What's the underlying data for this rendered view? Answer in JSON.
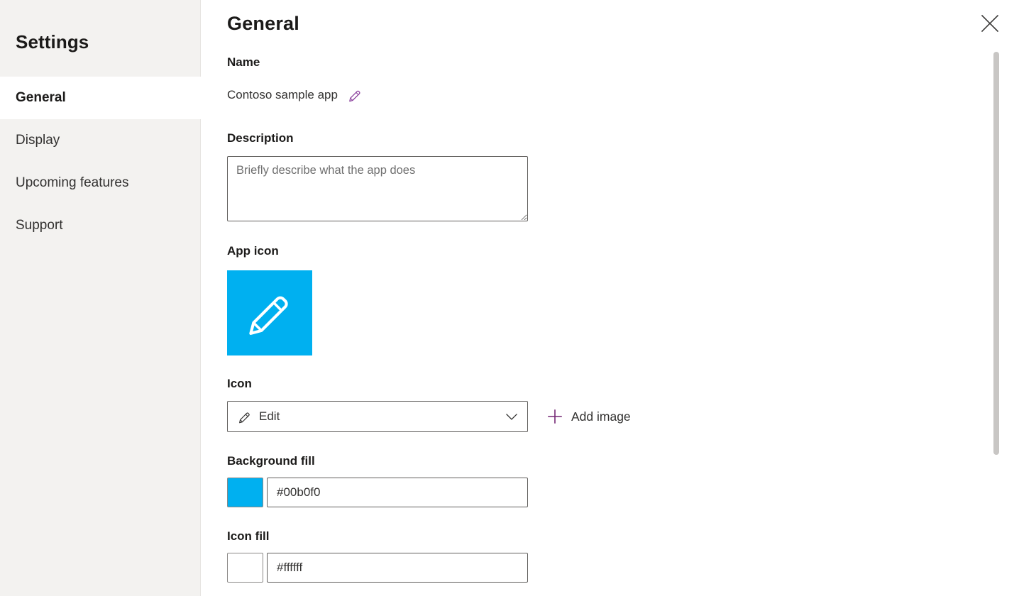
{
  "sidebar": {
    "title": "Settings",
    "items": [
      {
        "label": "General",
        "selected": true
      },
      {
        "label": "Display",
        "selected": false
      },
      {
        "label": "Upcoming features",
        "selected": false
      },
      {
        "label": "Support",
        "selected": false
      }
    ]
  },
  "header": {
    "title": "General",
    "close_label": "Close",
    "close_icon": "close-icon"
  },
  "form": {
    "name": {
      "label": "Name",
      "value": "Contoso sample app",
      "edit_icon": "pencil-icon",
      "edit_icon_color": "#8a3f9c"
    },
    "description": {
      "label": "Description",
      "value": "",
      "placeholder": "Briefly describe what the app does"
    },
    "app_icon": {
      "label": "App icon",
      "icon": "pencil-icon",
      "background_color": "#00b0f0",
      "icon_color": "#ffffff"
    },
    "icon": {
      "label": "Icon",
      "selected_option": "Edit",
      "option_icon": "pencil-icon",
      "chevron_icon": "chevron-down-icon",
      "add_image_label": "Add image",
      "add_image_icon": "plus-icon",
      "add_image_icon_color": "#742774"
    },
    "background_fill": {
      "label": "Background fill",
      "value": "#00b0f0",
      "swatch_color": "#00b0f0"
    },
    "icon_fill": {
      "label": "Icon fill",
      "value": "#ffffff",
      "swatch_color": "#ffffff"
    }
  },
  "scrollbar": {
    "name": "vertical-scrollbar"
  }
}
